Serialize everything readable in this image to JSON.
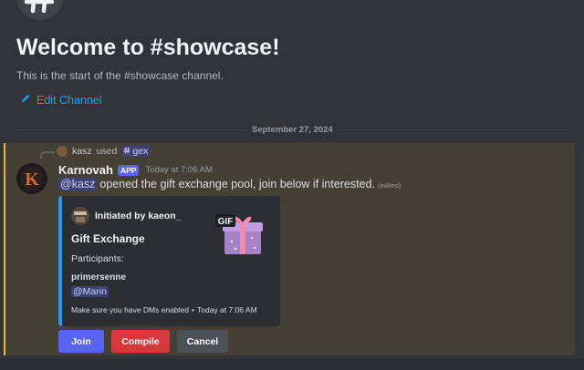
{
  "welcome": {
    "title": "Welcome to #showcase!",
    "subtitle": "This is the start of the #showcase channel.",
    "edit_label": "Edit Channel"
  },
  "divider": {
    "date": "September 27, 2024"
  },
  "message": {
    "reply": {
      "user": "kasz",
      "verb": "used",
      "command": "gex"
    },
    "author": "Karnovah",
    "badge": "APP",
    "timestamp": "Today at 7:06 AM",
    "mention": "@kasz",
    "text": "opened the gift exchange pool, join below if interested.",
    "edited": "(edited)",
    "highlight_color": "#f0b232",
    "embed": {
      "author": "Initiated by kaeon_",
      "title": "Gift Exchange",
      "description": "Participants:",
      "participant": "primersenne",
      "participant_mention": "@Marin",
      "footer_text": "Make sure you have DMs enabled",
      "footer_sep": "•",
      "footer_time": "Today at 7:06 AM",
      "thumbnail_label": "GIF",
      "accent_color": "#2297ff"
    },
    "buttons": {
      "join": "Join",
      "compile": "Compile",
      "cancel": "Cancel"
    }
  },
  "icons": {
    "channel": "hash-icon",
    "edit": "pencil-icon",
    "command": "slash-command-icon"
  }
}
